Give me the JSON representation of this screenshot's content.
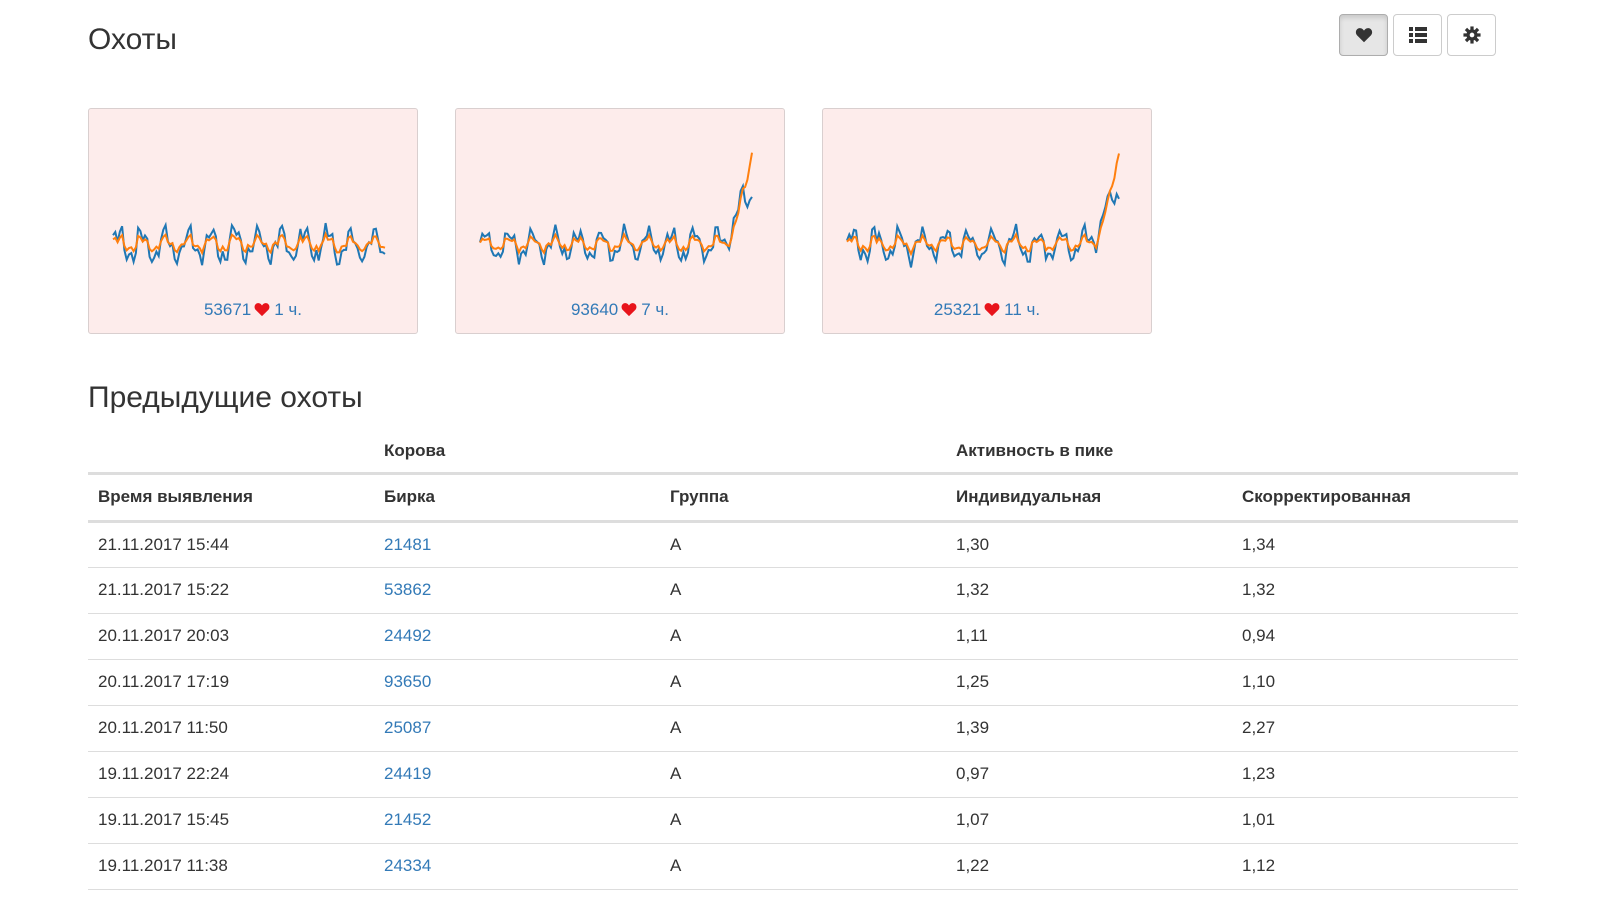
{
  "header": {
    "title": "Охоты",
    "toolbar": [
      {
        "icon": "heart-icon",
        "active": true
      },
      {
        "icon": "list-icon",
        "active": false
      },
      {
        "icon": "gear-icon",
        "active": false
      }
    ]
  },
  "colors": {
    "card_bg": "#fdeceb",
    "line_blue": "#1f77b4",
    "line_orange": "#ff7f0e",
    "link": "#337ab7",
    "heart": "#e8141b"
  },
  "cards": [
    {
      "tag": "53671",
      "time": "1 ч.",
      "spike": false
    },
    {
      "tag": "93640",
      "time": "7 ч.",
      "spike": true
    },
    {
      "tag": "25321",
      "time": "11 ч.",
      "spike": true
    }
  ],
  "history": {
    "title": "Предыдущие охоты",
    "group_headers": {
      "cow": "Корова",
      "activity": "Активность в пике"
    },
    "columns": [
      "Время выявления",
      "Бирка",
      "Группа",
      "Индивидуальная",
      "Скорректированная"
    ],
    "rows": [
      {
        "time": "21.11.2017 15:44",
        "tag": "21481",
        "group": "A",
        "individual": "1,30",
        "corrected": "1,34"
      },
      {
        "time": "21.11.2017 15:22",
        "tag": "53862",
        "group": "A",
        "individual": "1,32",
        "corrected": "1,32"
      },
      {
        "time": "20.11.2017 20:03",
        "tag": "24492",
        "group": "A",
        "individual": "1,11",
        "corrected": "0,94"
      },
      {
        "time": "20.11.2017 17:19",
        "tag": "93650",
        "group": "A",
        "individual": "1,25",
        "corrected": "1,10"
      },
      {
        "time": "20.11.2017 11:50",
        "tag": "25087",
        "group": "A",
        "individual": "1,39",
        "corrected": "2,27"
      },
      {
        "time": "19.11.2017 22:24",
        "tag": "24419",
        "group": "A",
        "individual": "0,97",
        "corrected": "1,23"
      },
      {
        "time": "19.11.2017 15:45",
        "tag": "21452",
        "group": "A",
        "individual": "1,07",
        "corrected": "1,01"
      },
      {
        "time": "19.11.2017 11:38",
        "tag": "24334",
        "group": "A",
        "individual": "1,22",
        "corrected": "1,12"
      }
    ]
  }
}
